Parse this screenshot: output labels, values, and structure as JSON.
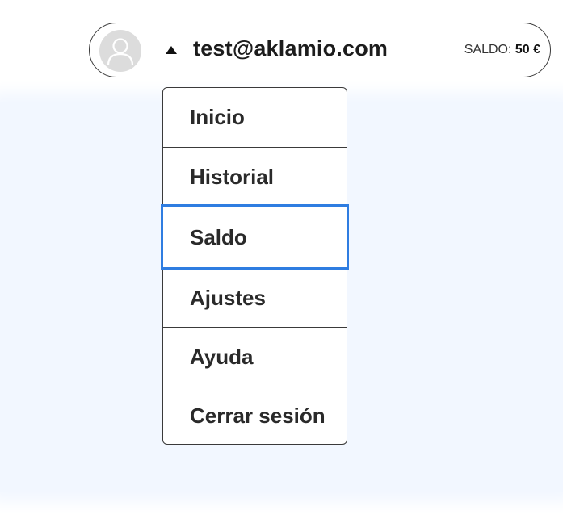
{
  "account": {
    "email": "test@aklamio.com",
    "balance_label": "SALDO:",
    "balance_amount": "50 €"
  },
  "icons": {
    "avatar": "user-avatar-icon",
    "caret": "caret-up-icon"
  },
  "colors": {
    "background_panel": "#f2f7ff",
    "selected_outline": "#2f7de1",
    "avatar_bg": "#dcdcdc"
  },
  "menu": {
    "items": [
      {
        "label": "Inicio"
      },
      {
        "label": "Historial"
      },
      {
        "label": "Saldo",
        "selected": true
      },
      {
        "label": "Ajustes"
      },
      {
        "label": "Ayuda"
      },
      {
        "label": "Cerrar sesión"
      }
    ]
  }
}
